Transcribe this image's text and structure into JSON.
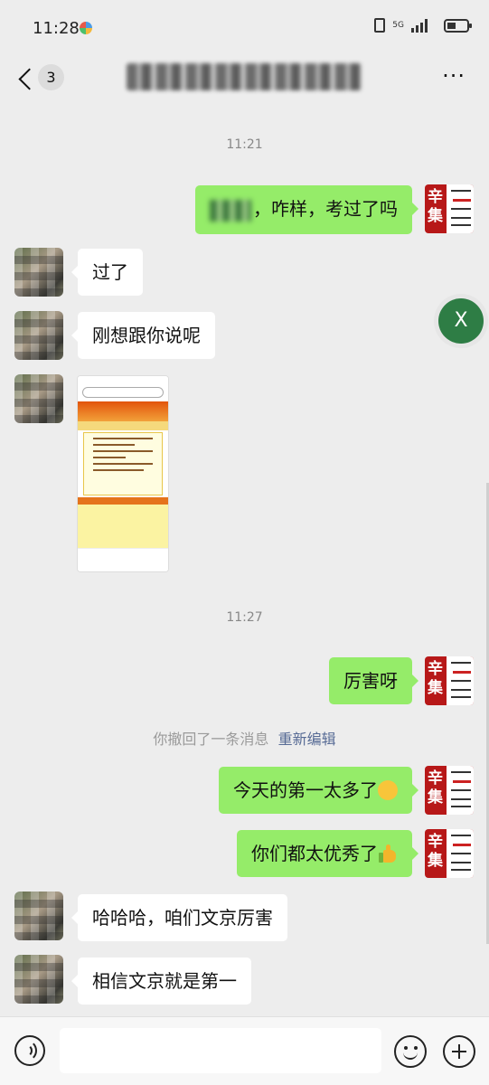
{
  "status_bar": {
    "time": "11:28",
    "network": "5G"
  },
  "header": {
    "back_badge": "3",
    "more_label": "···"
  },
  "messages": {
    "ts1": "11:21",
    "m1_text": "，咋样，考过了吗",
    "m2_text": "过了",
    "m3_text": "刚想跟你说呢",
    "ts2": "11:27",
    "m5_text": "厉害呀",
    "recall_text": "你撤回了一条消息",
    "recall_edit": "重新编辑",
    "m6_text": "今天的第一太多了",
    "m7_text": "你们都太优秀了",
    "m8_text": "哈哈哈，咱们文京厉害",
    "m9_text": "相信文京就是第一"
  },
  "my_avatar": {
    "chars": "辛集"
  },
  "floating": {
    "label": "X"
  }
}
